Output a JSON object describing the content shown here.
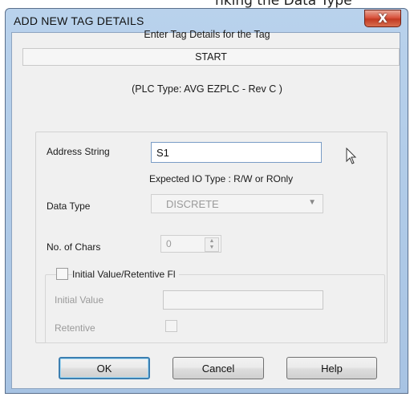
{
  "top_clip_text": "nking the Data Type",
  "window": {
    "title": "ADD NEW TAG DETAILS",
    "close_label": "X"
  },
  "header": {
    "prompt": "Enter Tag Details for the Tag",
    "tag_name": "START",
    "plc_type": "(PLC Type:  AVG EZPLC - Rev C )"
  },
  "form": {
    "address_label": "Address String",
    "address_value": "S1",
    "expected_io": "Expected IO Type : R/W or ROnly",
    "data_type_label": "Data Type",
    "data_type_value": "DISCRETE",
    "chars_label": "No. of Chars",
    "chars_value": "0",
    "initial_check_label": "Initial Value/Retentive Fl",
    "initial_value_label": "Initial Value",
    "initial_value_value": "",
    "retentive_label": "Retentive"
  },
  "buttons": {
    "ok": "OK",
    "cancel": "Cancel",
    "help": "Help"
  }
}
